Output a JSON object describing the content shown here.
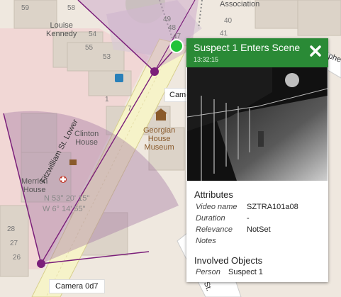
{
  "map": {
    "places": {
      "louise_kennedy": "Louise\nKennedy",
      "association": "Association",
      "clinton_house": "Clinton\nHouse",
      "georgian_museum": "Georgian\nHouse\nMuseum",
      "merrion_house": "Merrion\nHouse",
      "street": "Fitzwilliam St. Lower",
      "coords_1": "N 53° 20' 15\"",
      "coords_2": "W 6° 14' 55\""
    },
    "house_numbers": [
      "59",
      "58",
      "55",
      "54",
      "53",
      "49",
      "48",
      "47",
      "41",
      "40",
      "1",
      "7",
      "28",
      "27",
      "26"
    ],
    "colors": {
      "camera_purple": "#7b1f7a",
      "active_green": "#22c33a"
    }
  },
  "cameras": [
    {
      "label": "Camera 0d7"
    },
    {
      "label": "Came"
    }
  ],
  "popup": {
    "title": "Suspect 1 Enters Scene",
    "time": "13:32:15",
    "close_icon": "close-icon",
    "attributes_heading": "Attributes",
    "attributes": [
      {
        "key": "Video name",
        "value": "SZTRA101a08"
      },
      {
        "key": "Duration",
        "value": "-"
      },
      {
        "key": "Relevance",
        "value": "NotSet"
      },
      {
        "key": "Notes",
        "value": ""
      }
    ],
    "objects_heading": "Involved Objects",
    "objects": [
      {
        "key": "Person",
        "value": "Suspect 1"
      }
    ]
  },
  "edge_text": {
    "right_road": "phe",
    "bottom_road": "St."
  }
}
